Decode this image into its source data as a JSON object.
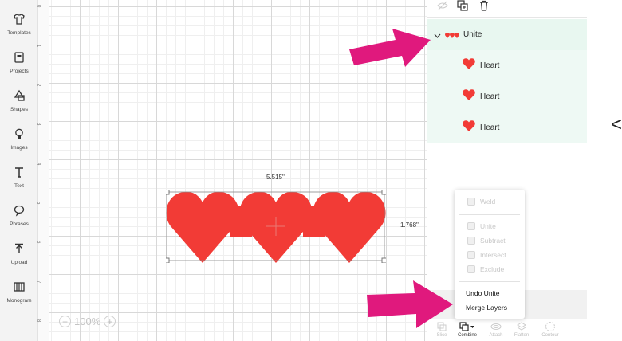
{
  "left_toolbar": {
    "items": [
      {
        "label": "Templates",
        "icon": "shirt-icon"
      },
      {
        "label": "Projects",
        "icon": "document-icon"
      },
      {
        "label": "Shapes",
        "icon": "shapes-icon"
      },
      {
        "label": "Images",
        "icon": "lightbulb-icon"
      },
      {
        "label": "Text",
        "icon": "text-icon"
      },
      {
        "label": "Phrases",
        "icon": "speech-bubble-icon"
      },
      {
        "label": "Upload",
        "icon": "upload-icon"
      },
      {
        "label": "Monogram",
        "icon": "monogram-icon"
      }
    ]
  },
  "ruler": {
    "marks": [
      "0",
      "1",
      "2",
      "3",
      "4",
      "5",
      "6",
      "7",
      "8"
    ]
  },
  "canvas": {
    "width_label": "5.515\"",
    "height_label": "1.768\"",
    "zoom_label": "100%",
    "zoom_out": "−",
    "zoom_in": "+",
    "heart_color": "#f23b36"
  },
  "layers": {
    "group": {
      "name": "Unite",
      "expand_icon": "chevron-down-icon"
    },
    "children": [
      {
        "name": "Heart"
      },
      {
        "name": "Heart"
      },
      {
        "name": "Heart"
      }
    ],
    "highlight_color": "#eef9f4"
  },
  "combine_menu": {
    "items": [
      {
        "label": "Weld",
        "enabled": false
      },
      {
        "label": "Unite",
        "enabled": false
      },
      {
        "label": "Subtract",
        "enabled": false
      },
      {
        "label": "Intersect",
        "enabled": false
      },
      {
        "label": "Exclude",
        "enabled": false
      },
      {
        "label": "Undo Unite",
        "enabled": true
      },
      {
        "label": "Merge Layers",
        "enabled": true
      }
    ]
  },
  "bottom_toolbar": {
    "items": [
      {
        "label": "Slice",
        "active": false
      },
      {
        "label": "Combine",
        "active": true
      },
      {
        "label": "Attach",
        "active": false
      },
      {
        "label": "Flatten",
        "active": false
      },
      {
        "label": "Contour",
        "active": false
      }
    ]
  },
  "annotation": {
    "arrow_color": "#e0197d"
  },
  "right_edge_glyph": "<"
}
